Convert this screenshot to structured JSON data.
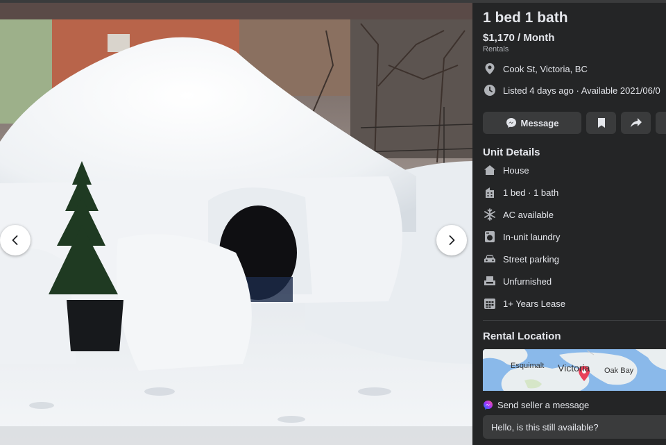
{
  "listing": {
    "title": "1 bed 1 bath",
    "price": "$1,170 / Month",
    "category": "Rentals",
    "location": "Cook St, Victoria, BC",
    "listed": "Listed 4 days ago · Available 2021/06/0"
  },
  "actions": {
    "message_label": "Message",
    "save_icon": "bookmark-icon",
    "share_icon": "share-icon"
  },
  "unit_details": {
    "heading": "Unit Details",
    "items": [
      {
        "icon": "house-icon",
        "label": "House"
      },
      {
        "icon": "building-icon",
        "label": "1 bed · 1 bath"
      },
      {
        "icon": "snowflake-icon",
        "label": "AC available"
      },
      {
        "icon": "washer-icon",
        "label": "In-unit laundry"
      },
      {
        "icon": "car-icon",
        "label": "Street parking"
      },
      {
        "icon": "armchair-icon",
        "label": "Unfurnished"
      },
      {
        "icon": "calendar-icon",
        "label": "1+ Years Lease"
      }
    ]
  },
  "rental_location": {
    "heading": "Rental Location",
    "map_labels": [
      "Esquimalt",
      "Victoria",
      "Oak Bay"
    ]
  },
  "contact": {
    "send_label": "Send seller a message",
    "message_text": "Hello, is this still available?"
  },
  "colors": {
    "panel_bg": "#242526",
    "button_bg": "#3a3b3c",
    "text_primary": "#e4e6eb",
    "text_secondary": "#b0b3b8",
    "map_pin": "#e8415a"
  }
}
